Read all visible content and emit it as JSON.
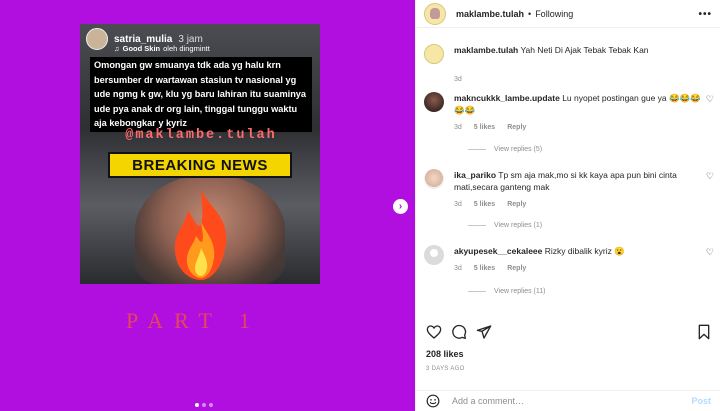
{
  "post": {
    "story": {
      "username": "satria_mulia",
      "time": "3 jam",
      "sub_label": "Good Skin",
      "sub_rest": "oleh dingmintt",
      "quote": "Omongan gw smuanya tdk ada yg halu krn bersumber dr wartawan stasiun tv nasional yg ude ngmg k gw, klu yg baru lahiran itu suaminya ude pya anak dr org lain, tinggal tunggu waktu aja kebongkar y kyriz",
      "handle": "@maklambe.tulah",
      "breaking": "BREAKING NEWS"
    },
    "part_label": "PART 1",
    "carousel": {
      "next_icon": "chevron-right-icon",
      "dots": 3,
      "active_dot": 0
    }
  },
  "header": {
    "username": "maklambe.tulah",
    "separator": "•",
    "follow_status": "Following",
    "more": "•••"
  },
  "caption": {
    "username": "maklambe.tulah",
    "text": "Yah Neti Di Ajak Tebak Tebak Kan",
    "time": "3d"
  },
  "comments": [
    {
      "username": "makncukkk_lambe.update",
      "text": "Lu nyopet postingan gue ya 😂😂😂😂😂",
      "time": "3d",
      "likes": "5 likes",
      "reply": "Reply",
      "view_replies": "View replies (5)"
    },
    {
      "username": "ika_pariko",
      "text": "Tp sm aja mak,mo si kk kaya apa pun bini cinta mati,secara ganteng mak",
      "time": "3d",
      "likes": "5 likes",
      "reply": "Reply",
      "view_replies": "View replies (1)"
    },
    {
      "username": "akyupesek__cekaleee",
      "text": "Rizky dibalik kyriz 😮",
      "time": "3d",
      "likes": "5 likes",
      "reply": "Reply",
      "view_replies": "View replies (11)"
    }
  ],
  "actions": {
    "like_icon": "heart-icon",
    "comment_icon": "comment-icon",
    "share_icon": "share-icon",
    "save_icon": "bookmark-icon"
  },
  "likes": "208 likes",
  "posted_ago": "3 DAYS AGO",
  "add_comment": {
    "placeholder": "Add a comment…",
    "post_label": "Post"
  }
}
